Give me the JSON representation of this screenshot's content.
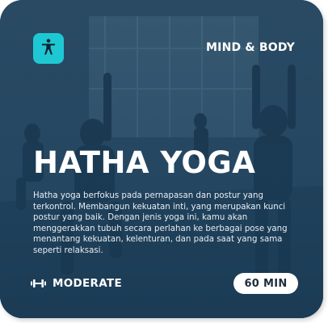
{
  "card": {
    "category": "MIND & BODY",
    "title": "HATHA YOGA",
    "description": "Hatha yoga berfokus pada pernapasan dan postur yang terkontrol. Membangun kekuatan inti, yang merupakan kunci postur yang baik. Dengan jenis yoga ini, kamu akan menggerakkan tubuh secara perlahan ke berbagai pose yang menantang kekuatan, kelenturan, dan pada saat yang sama seperti relaksasi.",
    "level_label": "MODERATE",
    "duration_label": "60 MIN",
    "icons": {
      "badge": "person-accessibility-icon",
      "level": "dumbbell-icon"
    },
    "colors": {
      "badge": "#1ec8d3",
      "card_tint": "#2b4a63",
      "pill_bg": "#ffffff",
      "pill_text": "#1d2d3b"
    }
  }
}
